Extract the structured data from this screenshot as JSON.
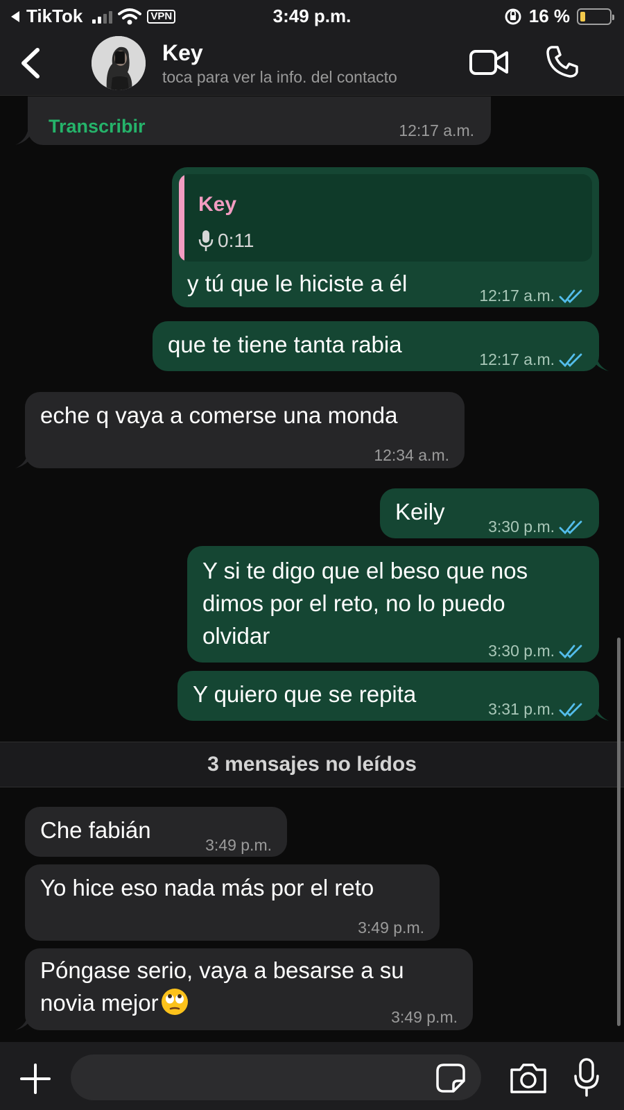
{
  "status_bar": {
    "back_app": "TikTok",
    "vpn": "VPN",
    "time": "3:49 p.m.",
    "battery": "16 %",
    "battery_level": 0.16,
    "signal_bars": 2
  },
  "header": {
    "contact_name": "Key",
    "subtitle": "toca para ver la info. del contacto",
    "icons": {
      "back": "chevron-left-icon",
      "video": "video-camera-icon",
      "call": "phone-icon"
    }
  },
  "messages": {
    "m0": {
      "transcribe": "Transcribir",
      "time": "12:17 a.m."
    },
    "m1": {
      "quote_name": "Key",
      "quote_audio": "0:11",
      "text": "y tú que le hiciste a él",
      "time": "12:17 a.m."
    },
    "m2": {
      "text": "que te tiene tanta rabia",
      "time": "12:17 a.m."
    },
    "m3": {
      "text": "eche q vaya a comerse una monda",
      "time": "12:34 a.m."
    },
    "m4": {
      "text": "Keily",
      "time": "3:30 p.m."
    },
    "m5": {
      "line1": "Y si te digo que el beso que nos",
      "line2": "dimos por el reto, no lo puedo",
      "line3": "olvidar",
      "time": "3:30 p.m."
    },
    "m6": {
      "text": "Y quiero que se repita",
      "time": "3:31 p.m."
    },
    "m7": {
      "text": "Che fabián",
      "time": "3:49 p.m."
    },
    "m8": {
      "text": "Yo hice eso nada más por el reto",
      "time": "3:49 p.m."
    },
    "m9": {
      "line1": "Póngase serio, vaya a besarse a su",
      "line2": "novia mejor",
      "emoji": "face-with-rolling-eyes-emoji",
      "time": "3:49 p.m."
    }
  },
  "unread_label": "3 mensajes no leídos",
  "input": {
    "placeholder": "",
    "icons": {
      "plus": "plus-icon",
      "sticker": "sticker-icon",
      "camera": "camera-icon",
      "mic": "microphone-icon"
    }
  },
  "colors": {
    "incoming_bubble": "#262628",
    "outgoing_bubble": "#154633",
    "read_ticks": "#53bdeb",
    "accent_green": "#25b36a",
    "quote_pink": "#f29cc1"
  }
}
